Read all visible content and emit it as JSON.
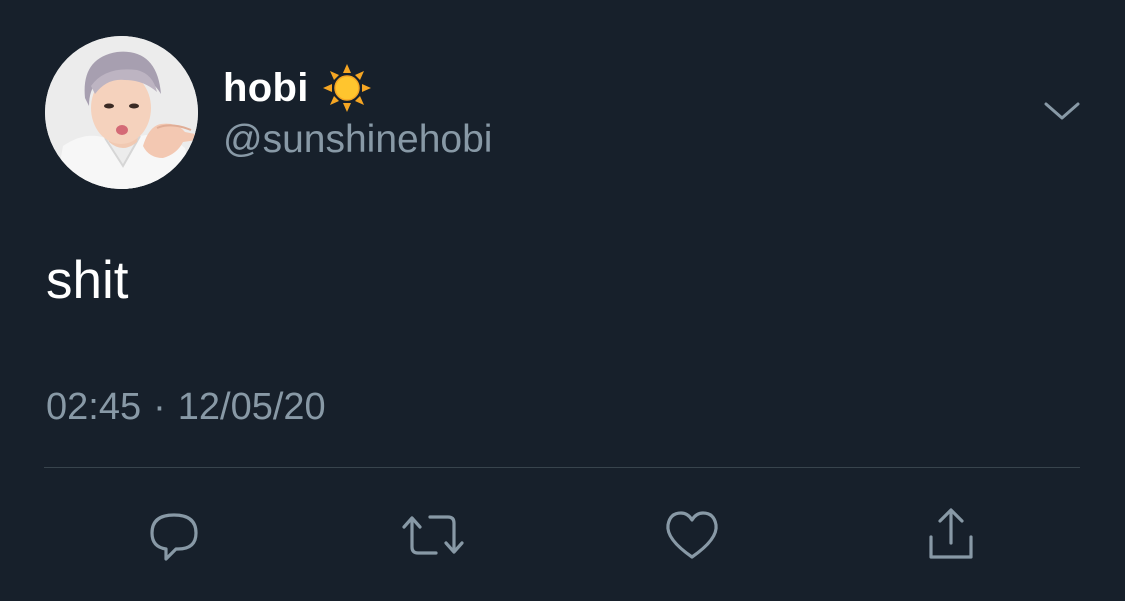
{
  "tweet": {
    "display_name": "hobi",
    "handle": "@sunshinehobi",
    "text": "shit",
    "time": "02:45",
    "separator": "·",
    "date": "12/05/20"
  },
  "icons": {
    "name_emoji": "sun-icon",
    "menu": "chevron-down-icon",
    "actions": [
      "reply-icon",
      "retweet-icon",
      "like-icon",
      "share-icon"
    ]
  },
  "colors": {
    "background": "#17202b",
    "primary_text": "#ffffff",
    "secondary_text": "#8899a6",
    "divider": "#38444d"
  }
}
